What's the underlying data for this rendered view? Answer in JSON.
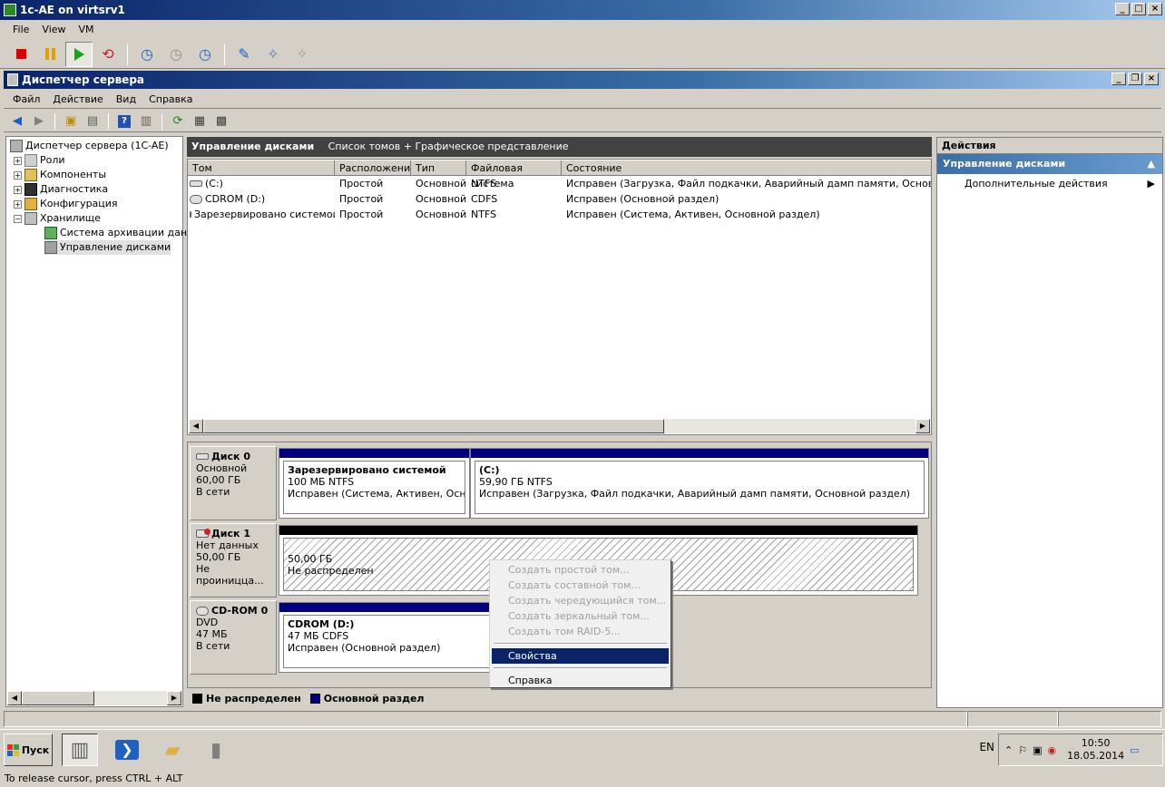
{
  "outer_window": {
    "title": "1c-AE on virtsrv1",
    "menu": [
      "File",
      "View",
      "VM"
    ]
  },
  "inner_window": {
    "title": "Диспетчер сервера",
    "menu": [
      "Файл",
      "Действие",
      "Вид",
      "Справка"
    ]
  },
  "tree": {
    "root": "Диспетчер сервера (1C-AE)",
    "items": [
      {
        "label": "Роли",
        "expander": "+"
      },
      {
        "label": "Компоненты",
        "expander": "+"
      },
      {
        "label": "Диагностика",
        "expander": "+"
      },
      {
        "label": "Конфигурация",
        "expander": "+"
      },
      {
        "label": "Хранилище",
        "expander": "−"
      }
    ],
    "children": [
      {
        "label": "Система архивации данн"
      },
      {
        "label": "Управление дисками"
      }
    ]
  },
  "center": {
    "header_title": "Управление дисками",
    "header_sub": "Список томов + Графическое представление",
    "columns": [
      "Том",
      "Расположение",
      "Тип",
      "Файловая система",
      "Состояние"
    ],
    "rows": [
      {
        "vol": "(C:)",
        "loc": "Простой",
        "type": "Основной",
        "fs": "NTFS",
        "state": "Исправен (Загрузка, Файл подкачки, Аварийный дамп памяти, Основной разде"
      },
      {
        "vol": "CDROM (D:)",
        "loc": "Простой",
        "type": "Основной",
        "fs": "CDFS",
        "state": "Исправен (Основной раздел)"
      },
      {
        "vol": "Зарезервировано системой",
        "loc": "Простой",
        "type": "Основной",
        "fs": "NTFS",
        "state": "Исправен (Система, Активен, Основной раздел)"
      }
    ]
  },
  "disks": {
    "disk0": {
      "name": "Диск 0",
      "type": "Основной",
      "size": "60,00 ГБ",
      "status": "В сети",
      "p1": {
        "title": "Зарезервировано системой",
        "size": "100 МБ NTFS",
        "state": "Исправен (Система, Активен, Основнс"
      },
      "p2": {
        "title": "(C:)",
        "size": "59,90 ГБ NTFS",
        "state": "Исправен (Загрузка, Файл подкачки, Аварийный дамп памяти, Основной раздел)"
      }
    },
    "disk1": {
      "name": "Диск 1",
      "type": "Нет данных",
      "size": "50,00 ГБ",
      "status": "Не проиницца...",
      "p1": {
        "size": "50,00 ГБ",
        "state": "Не распределен"
      }
    },
    "cdrom0": {
      "name": "CD-ROM 0",
      "type": "DVD",
      "size": "47 МБ",
      "status": "В сети",
      "p1": {
        "title": "CDROM  (D:)",
        "size": "47 МБ CDFS",
        "state": "Исправен (Основной раздел)"
      }
    }
  },
  "legend": {
    "unallocated": "Не распределен",
    "primary": "Основной раздел",
    "unallocated_color": "#000000",
    "primary_color": "#000080"
  },
  "actions": {
    "title": "Действия",
    "section": "Управление дисками",
    "item": "Дополнительные действия"
  },
  "context_menu": {
    "disabled": [
      "Создать простой том...",
      "Создать составной том...",
      "Создать чередующийся том...",
      "Создать зеркальный том...",
      "Создать том RAID-5..."
    ],
    "selected": "Свойства",
    "help": "Справка"
  },
  "taskbar": {
    "start": "Пуск",
    "lang": "EN",
    "time": "10:50",
    "date": "18.05.2014"
  },
  "bottom_status": "To release cursor, press CTRL + ALT"
}
